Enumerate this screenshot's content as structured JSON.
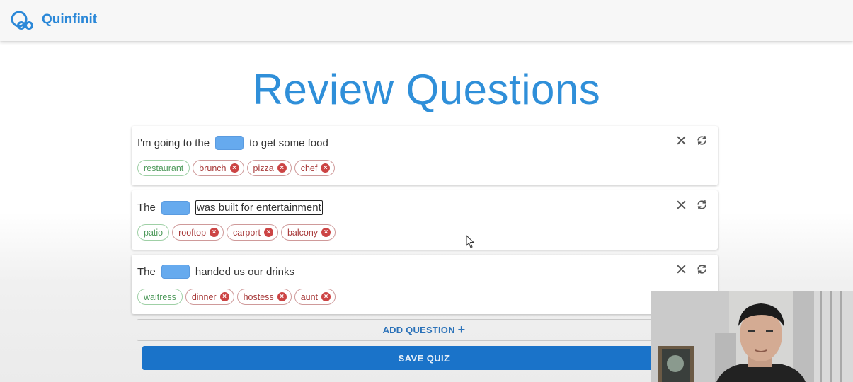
{
  "app": {
    "brand": "Quinfinit"
  },
  "page": {
    "title": "Review Questions"
  },
  "questions": [
    {
      "before": "I'm going to the",
      "after": "to get some food",
      "choices": [
        {
          "label": "restaurant",
          "correct": true
        },
        {
          "label": "brunch",
          "correct": false
        },
        {
          "label": "pizza",
          "correct": false
        },
        {
          "label": "chef",
          "correct": false
        }
      ]
    },
    {
      "before": "The",
      "after": "was built for entertainment",
      "choices": [
        {
          "label": "patio",
          "correct": true
        },
        {
          "label": "rooftop",
          "correct": false
        },
        {
          "label": "carport",
          "correct": false
        },
        {
          "label": "balcony",
          "correct": false
        }
      ]
    },
    {
      "before": "The",
      "after": "handed us our drinks",
      "choices": [
        {
          "label": "waitress",
          "correct": true
        },
        {
          "label": "dinner",
          "correct": false
        },
        {
          "label": "hostess",
          "correct": false
        },
        {
          "label": "aunt",
          "correct": false
        }
      ]
    }
  ],
  "actions": {
    "add_question": "ADD QUESTION",
    "save_quiz": "SAVE QUIZ"
  },
  "colors": {
    "brand": "#2b88d8",
    "blank": "#66aaee",
    "correct": "#4f9a5c",
    "wrong": "#a83a3a",
    "save": "#1a73c9"
  }
}
